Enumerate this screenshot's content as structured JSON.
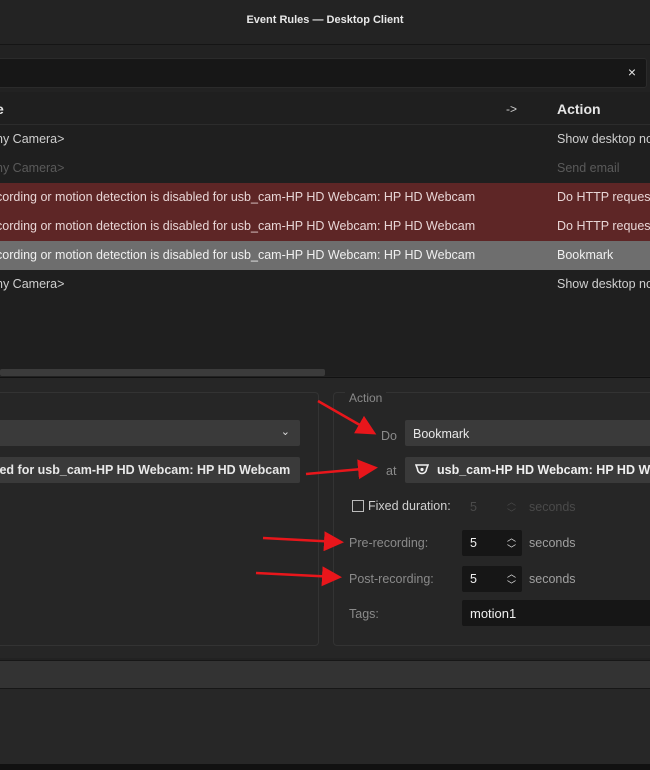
{
  "window": {
    "title": "Event Rules — Desktop Client"
  },
  "filter": {
    "clear_icon": "×"
  },
  "table": {
    "headers": {
      "event": "e",
      "arrow": "->",
      "action": "Action"
    },
    "rows": [
      {
        "event": "ny Camera>",
        "action": "Show desktop no",
        "state": "normal"
      },
      {
        "event": "ny Camera>",
        "action": "Send email",
        "state": "disabled"
      },
      {
        "event": "cording or motion detection is disabled for usb_cam-HP HD Webcam: HP HD Webcam",
        "action": "Do HTTP reques",
        "state": "red"
      },
      {
        "event": "cording or motion detection is disabled for usb_cam-HP HD Webcam: HP HD Webcam",
        "action": "Do HTTP reques",
        "state": "red"
      },
      {
        "event": "cording or motion detection is disabled for usb_cam-HP HD Webcam: HP HD Webcam",
        "action": "Bookmark",
        "state": "selected"
      },
      {
        "event": "ny Camera>",
        "action": "Show desktop no",
        "state": "normal"
      }
    ]
  },
  "event_panel": {
    "source_combo": {
      "chevron": "⌄"
    },
    "camera_field": "led for usb_cam-HP HD Webcam: HP HD Webcam"
  },
  "action_panel": {
    "group_title": "Action",
    "do_label": "Do",
    "do_value": "Bookmark",
    "at_label": "at",
    "at_value": "usb_cam-HP HD Webcam: HP HD We",
    "camera_icon": "camera-icon",
    "fixed_duration": {
      "label": "Fixed duration:",
      "value": "5",
      "unit": "seconds",
      "checked": false
    },
    "pre_recording": {
      "label": "Pre-recording:",
      "value": "5",
      "unit": "seconds"
    },
    "post_recording": {
      "label": "Post-recording:",
      "value": "5",
      "unit": "seconds"
    },
    "tags": {
      "label": "Tags:",
      "value": "motion1"
    }
  },
  "annotation_color": "#e8161b"
}
